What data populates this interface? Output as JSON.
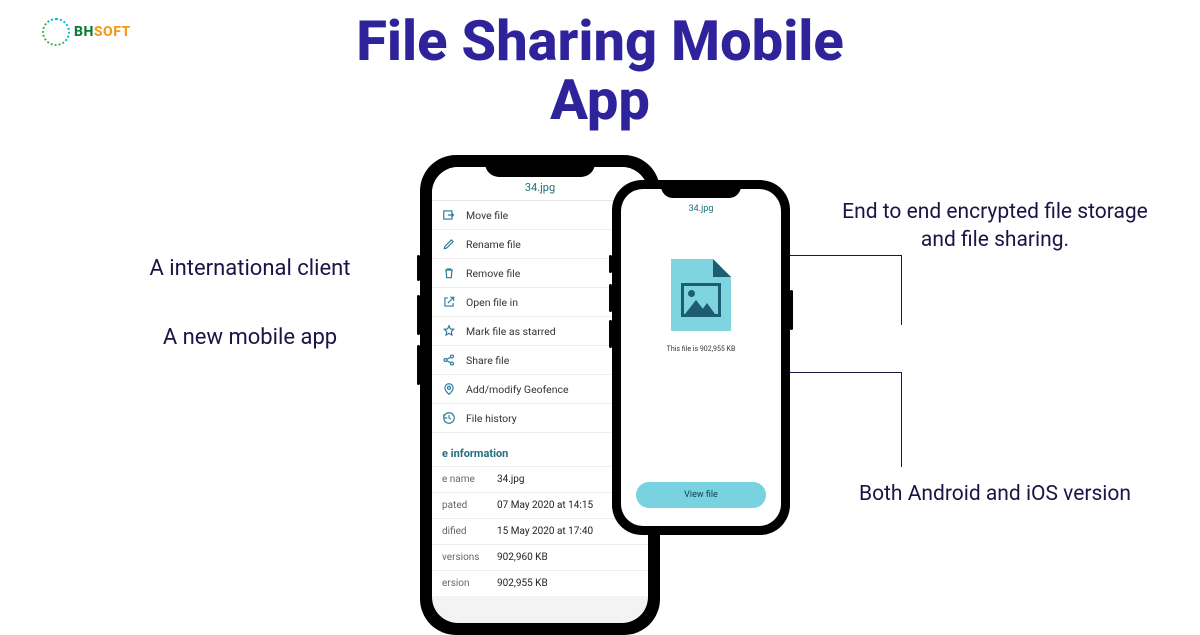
{
  "logo": {
    "bh": "BH",
    "soft": "SOFT"
  },
  "title_line1": "File Sharing Mobile",
  "title_line2": "App",
  "left": {
    "line1": "A international client",
    "line2": "A new mobile app"
  },
  "right": {
    "encrypted": "End to end encrypted file storage and file sharing.",
    "platforms": "Both Android and iOS version"
  },
  "phone1": {
    "title": "34.jpg",
    "menu": [
      "Move file",
      "Rename file",
      "Remove file",
      "Open file in",
      "Mark file as starred",
      "Share file",
      "Add/modify Geofence",
      "File history"
    ],
    "section": "e information",
    "info": [
      {
        "k": "e name",
        "v": "34.jpg"
      },
      {
        "k": "pated",
        "v": "07 May 2020 at 14:15"
      },
      {
        "k": "dified",
        "v": "15 May 2020 at 17:40"
      },
      {
        "k": "versions",
        "v": "902,960 KB"
      },
      {
        "k": "ersion",
        "v": "902,955 KB"
      }
    ]
  },
  "phone2": {
    "title": "34.jpg",
    "caption": "This file is 902,955 KB",
    "button": "View file"
  }
}
